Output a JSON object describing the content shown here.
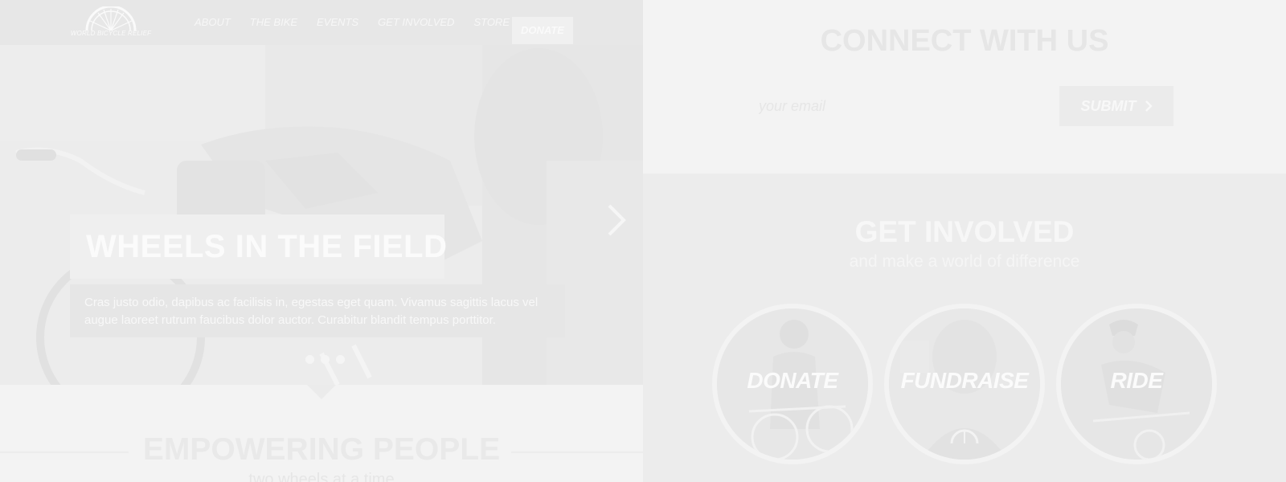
{
  "brand": {
    "logo_text": "WORLD BICYCLE RELIEF"
  },
  "nav": {
    "links": [
      "ABOUT",
      "THE BIKE",
      "EVENTS",
      "GET INVOLVED",
      "STORE"
    ],
    "donate_label": "DONATE"
  },
  "hero": {
    "title": "WHEELS IN THE FIELD",
    "description": "Cras justo odio, dapibus ac facilisis in, egestas eget quam. Vivamus sagittis lacus vel augue laoreet rutrum faucibus dolor auctor. Curabitur blandit tempus porttitor.",
    "slide_count": 3
  },
  "empower": {
    "title": "EMPOWERING PEOPLE",
    "subtitle": "two wheels at a time"
  },
  "connect": {
    "title": "CONNECT WITH US",
    "email_placeholder": "your email",
    "submit_label": "SUBMIT"
  },
  "involved": {
    "title": "GET INVOLVED",
    "subtitle": "and make a world of difference",
    "actions": [
      {
        "label": "DONATE",
        "icon": "person-with-bicycle-photo"
      },
      {
        "label": "FUNDRAISE",
        "icon": "smiling-person-photo"
      },
      {
        "label": "RIDE",
        "icon": "cyclist-photo"
      }
    ]
  }
}
